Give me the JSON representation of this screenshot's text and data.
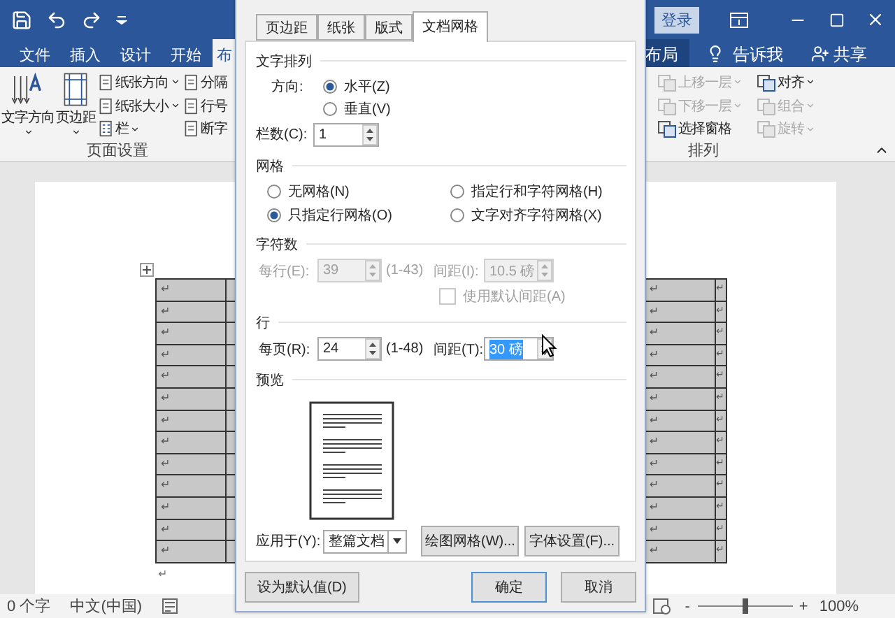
{
  "title_bar": {
    "sign_in": "登录"
  },
  "ribbon_tabs": [
    {
      "label": "文件",
      "selected": false
    },
    {
      "label": "插入",
      "selected": false
    },
    {
      "label": "设计",
      "selected": false
    },
    {
      "label": "开始",
      "selected": false
    },
    {
      "label": "布",
      "selected": true
    }
  ],
  "contextual_tab": {
    "label": "布局"
  },
  "tell_me": "告诉我",
  "share": "共享",
  "page_setup_group": {
    "label": "页面设置",
    "large_buttons": [
      {
        "label": "文字方向"
      },
      {
        "label": "页边距"
      }
    ],
    "small_buttons": [
      {
        "label": "纸张方向",
        "dropdown": true
      },
      {
        "label": "纸张大小",
        "dropdown": true
      },
      {
        "label": "栏",
        "dropdown": true
      },
      {
        "label": "分隔",
        "dropdown": false
      },
      {
        "label": "行号",
        "dropdown": false
      },
      {
        "label": "断字",
        "dropdown": false
      }
    ]
  },
  "arrange_group": {
    "label": "排列",
    "buttons": [
      {
        "label": "上移一层",
        "dropdown": true,
        "disabled": true
      },
      {
        "label": "下移一层",
        "dropdown": true,
        "disabled": true
      },
      {
        "label": "选择窗格",
        "dropdown": false,
        "disabled": false
      },
      {
        "label": "对齐",
        "dropdown": true,
        "disabled": false
      },
      {
        "label": "组合",
        "dropdown": true,
        "disabled": true
      },
      {
        "label": "旋转",
        "dropdown": true,
        "disabled": true
      }
    ]
  },
  "document": {
    "table_rows": [
      [
        "↵",
        "↵",
        "↵"
      ],
      [
        "↵",
        "↵",
        "↵"
      ],
      [
        "↵",
        "↵",
        "↵"
      ],
      [
        "↵",
        "↵",
        "↵"
      ],
      [
        "↵",
        "↵",
        "↵"
      ],
      [
        "↵",
        "↵",
        "↵"
      ],
      [
        "↵",
        "↵",
        "↵"
      ],
      [
        "↵",
        "↵",
        "↵"
      ],
      [
        "↵",
        "↵",
        "↵"
      ],
      [
        "↵",
        "↵",
        "↵"
      ],
      [
        "↵",
        "↵",
        "↵"
      ],
      [
        "↵",
        "↵",
        "↵"
      ],
      [
        "↵",
        "↵",
        "↵"
      ]
    ],
    "end_mark": "↵"
  },
  "status_bar": {
    "word_count": "0 个字",
    "language": "中文(中国)",
    "zoom_out": "-",
    "zoom_in": "+",
    "zoom": {
      "level": 0.5,
      "reading": "100%"
    }
  },
  "dialog": {
    "tabs": [
      {
        "label": "页边距",
        "selected": false
      },
      {
        "label": "纸张",
        "selected": false
      },
      {
        "label": "版式",
        "selected": false
      },
      {
        "label": "文档网格",
        "selected": true
      }
    ],
    "text_direction": {
      "heading": "文字排列",
      "label": "方向:",
      "options": [
        {
          "label": "水平(Z)",
          "selected": true
        },
        {
          "label": "垂直(V)",
          "selected": false
        }
      ],
      "columns_label": "栏数(C):",
      "columns_value": "1"
    },
    "grid": {
      "heading": "网格",
      "options": [
        {
          "label": "无网格(N)",
          "selected": false
        },
        {
          "label": "指定行和字符网格(H)",
          "selected": false
        },
        {
          "label": "只指定行网格(O)",
          "selected": true
        },
        {
          "label": "文字对齐字符网格(X)",
          "selected": false
        }
      ]
    },
    "characters": {
      "heading": "字符数",
      "disabled": true,
      "count_label": "每行(E):",
      "count_value": "39",
      "range": "(1-43)",
      "pitch_label": "间距(I):",
      "pitch_value": "10.5 磅",
      "pitch_selected": false,
      "default_pitch": {
        "label": "使用默认间距(A)",
        "checked": false
      }
    },
    "lines": {
      "heading": "行",
      "disabled": false,
      "count_label": "每页(R):",
      "count_value": "24",
      "range": "(1-48)",
      "pitch_label": "间距(T):",
      "pitch_value": "30 磅",
      "pitch_selected": true
    },
    "preview": {
      "heading": "预览"
    },
    "apply_to": {
      "label": "应用于(Y):",
      "value": "整篇文档"
    },
    "drawing_grid": "绘图网格(W)...",
    "font_settings": "字体设置(F)...",
    "footer": {
      "set_default": "设为默认值(D)",
      "ok": "确定",
      "cancel": "取消"
    }
  }
}
